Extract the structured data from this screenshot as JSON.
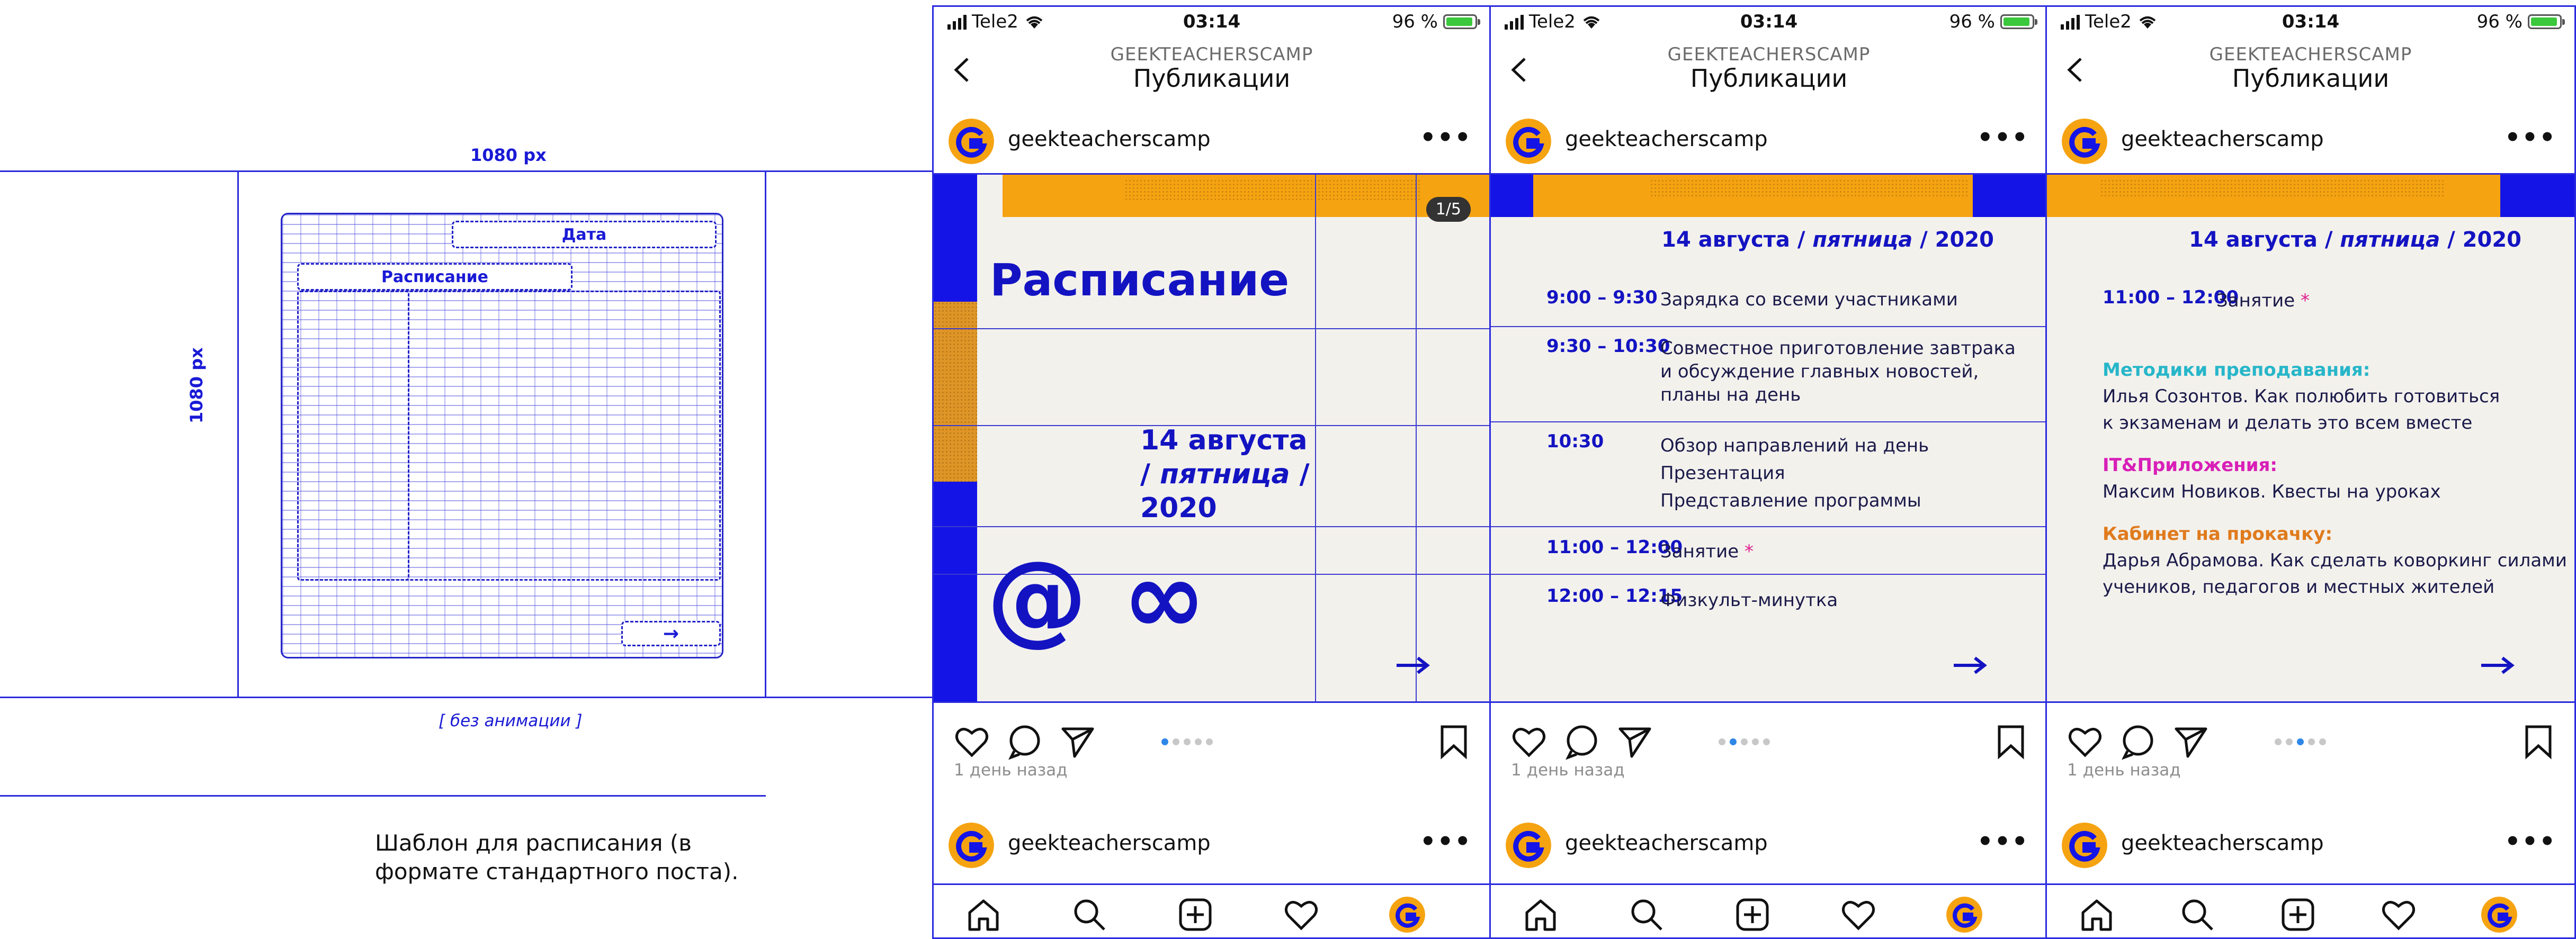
{
  "template": {
    "width_label": "1080 px",
    "height_label": "1080 px",
    "date_box": "Дата",
    "schedule_box": "Расписание",
    "arrow": "→",
    "no_animation": "[ без анимации ]",
    "caption": "Шаблон для расписания (в формате стандартного поста)."
  },
  "phone": {
    "carrier": "Tele2",
    "time": "03:14",
    "battery": "96 %",
    "account_caps": "GEEKTEACHERSCAMP",
    "screen_title": "Публикации",
    "username": "geekteacherscamp",
    "more": "•••",
    "posted_ago": "1 день назад",
    "icons": {
      "back": "chevron-left-icon",
      "like": "heart-icon",
      "comment": "comment-icon",
      "share": "send-icon",
      "save": "bookmark-icon",
      "home": "home-icon",
      "search": "search-icon",
      "add": "plus-square-icon",
      "activity": "heart-icon"
    }
  },
  "slide1": {
    "counter": "1/5",
    "title": "Расписание",
    "date_line1": "14 августа",
    "date_line2_prefix": "/ ",
    "date_line2_italic": "пятница",
    "date_line2_suffix": " /",
    "date_line3": "2020",
    "symbols": "@ ∞",
    "arrow": "→",
    "active_dot": 1
  },
  "slide2": {
    "date_prefix": "14 августа / ",
    "date_italic": "пятница",
    "date_suffix": " / 2020",
    "rows": [
      {
        "time": "9:00 – 9:30",
        "text": "Зарядка со всеми участниками"
      },
      {
        "time": "9:30 – 10:30",
        "text": "Совместное приготовление завтрака",
        "text2": "и обсуждение главных новостей,",
        "text3": "планы на день"
      },
      {
        "time": "10:30",
        "text": "Обзор направлений на день",
        "text2": "Презентация",
        "text3": "Представление программы"
      },
      {
        "time": "11:00 – 12:00",
        "text": "Занятие",
        "star": "*"
      },
      {
        "time": "12:00 – 12:15",
        "text": "Физкульт-минутка"
      }
    ],
    "arrow": "→",
    "active_dot": 2
  },
  "slide3": {
    "date_prefix": "14 августа / ",
    "date_italic": "пятница",
    "date_suffix": " / 2020",
    "time": "11:00 – 12:00",
    "lesson": "Занятие",
    "star": "*",
    "tracks": [
      {
        "title": "Методики преподавания:",
        "line1": "Илья Созонтов. Как полюбить готовиться",
        "line2": "к экзаменам и делать это всем вместе",
        "color": "#27b6c9"
      },
      {
        "title": "IT&Приложения:",
        "line1": "Максим Новиков. Квесты на уроках",
        "color": "#d81fb8"
      },
      {
        "title": "Кабинет на прокачку:",
        "line1": "Дарья Абрамова. Как сделать коворкинг силами",
        "line2": "учеников, педагогов и местных жителей",
        "color": "#e07b1d"
      }
    ],
    "arrow": "→",
    "active_dot": 3
  },
  "colors": {
    "accent_blue": "#1414e6",
    "accent_orange": "#f5a311",
    "dot_active": "#2f87e8"
  }
}
